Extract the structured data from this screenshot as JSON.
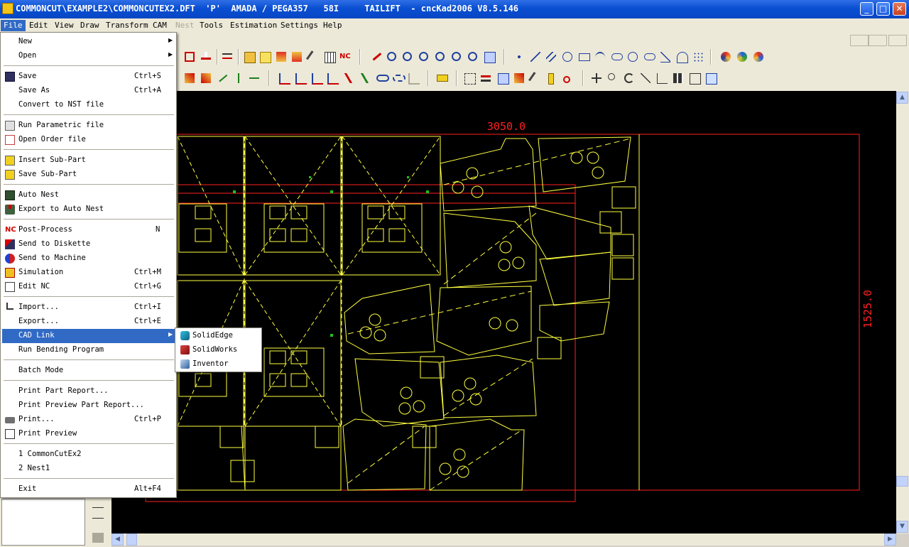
{
  "window": {
    "title": "COMMONCUT\\EXAMPLE2\\COMMONCUTEX2.DFT  'P'  AMADA / PEGA357   58I     TAILIFT  - cncKad2006 V8.5.146",
    "minimize": "_",
    "maximize": "□",
    "close": "✕"
  },
  "menubar": [
    {
      "label": "File",
      "state": "active"
    },
    {
      "label": "Edit",
      "state": "normal"
    },
    {
      "label": "View",
      "state": "normal"
    },
    {
      "label": "Draw",
      "state": "normal"
    },
    {
      "label": "Transform",
      "state": "normal"
    },
    {
      "label": "CAM",
      "state": "normal"
    },
    {
      "label": "Nest",
      "state": "disabled"
    },
    {
      "label": "Tools",
      "state": "normal"
    },
    {
      "label": "Estimation",
      "state": "normal"
    },
    {
      "label": "Settings",
      "state": "normal"
    },
    {
      "label": "Help",
      "state": "normal"
    }
  ],
  "file_menu": {
    "new": {
      "label": "New"
    },
    "open": {
      "label": "Open"
    },
    "save": {
      "label": "Save",
      "shortcut": "Ctrl+S"
    },
    "save_as": {
      "label": "Save As",
      "shortcut": "Ctrl+A"
    },
    "convert_nst": {
      "label": "Convert to NST file"
    },
    "run_parametric": {
      "label": "Run Parametric file"
    },
    "open_order": {
      "label": "Open Order file"
    },
    "insert_subpart": {
      "label": "Insert Sub-Part"
    },
    "save_subpart": {
      "label": "Save Sub-Part"
    },
    "auto_nest": {
      "label": "Auto Nest"
    },
    "export_auto_nest": {
      "label": "Export to Auto Nest"
    },
    "post_process": {
      "label": "Post-Process",
      "shortcut": "N"
    },
    "send_diskette": {
      "label": "Send to Diskette"
    },
    "send_machine": {
      "label": "Send to Machine"
    },
    "simulation": {
      "label": "Simulation",
      "shortcut": "Ctrl+M"
    },
    "edit_nc": {
      "label": "Edit NC",
      "shortcut": "Ctrl+G"
    },
    "import": {
      "label": "Import...",
      "shortcut": "Ctrl+I"
    },
    "export": {
      "label": "Export...",
      "shortcut": "Ctrl+E"
    },
    "cad_link": {
      "label": "CAD Link"
    },
    "run_bending": {
      "label": "Run Bending Program"
    },
    "batch_mode": {
      "label": "Batch Mode"
    },
    "print_part_report": {
      "label": "Print Part Report..."
    },
    "print_preview_report": {
      "label": "Print Preview Part Report..."
    },
    "print": {
      "label": "Print...",
      "shortcut": "Ctrl+P"
    },
    "print_preview": {
      "label": "Print Preview"
    },
    "recent_1": {
      "label": "1 CommonCutEx2"
    },
    "recent_2": {
      "label": "2 Nest1"
    },
    "exit": {
      "label": "Exit",
      "shortcut": "Alt+F4"
    }
  },
  "cad_link_submenu": [
    {
      "label": "SolidEdge",
      "icon": "solidedge-icon"
    },
    {
      "label": "SolidWorks",
      "icon": "solidworks-icon"
    },
    {
      "label": "Inventor",
      "icon": "inventor-icon"
    }
  ],
  "icons": {
    "nc_text": "NC"
  },
  "drawing": {
    "width_dimension": "3050.0",
    "height_dimension": "1525.0",
    "sheet_color": "#ff2020",
    "part_color": "#ffff40",
    "background": "#000000"
  }
}
